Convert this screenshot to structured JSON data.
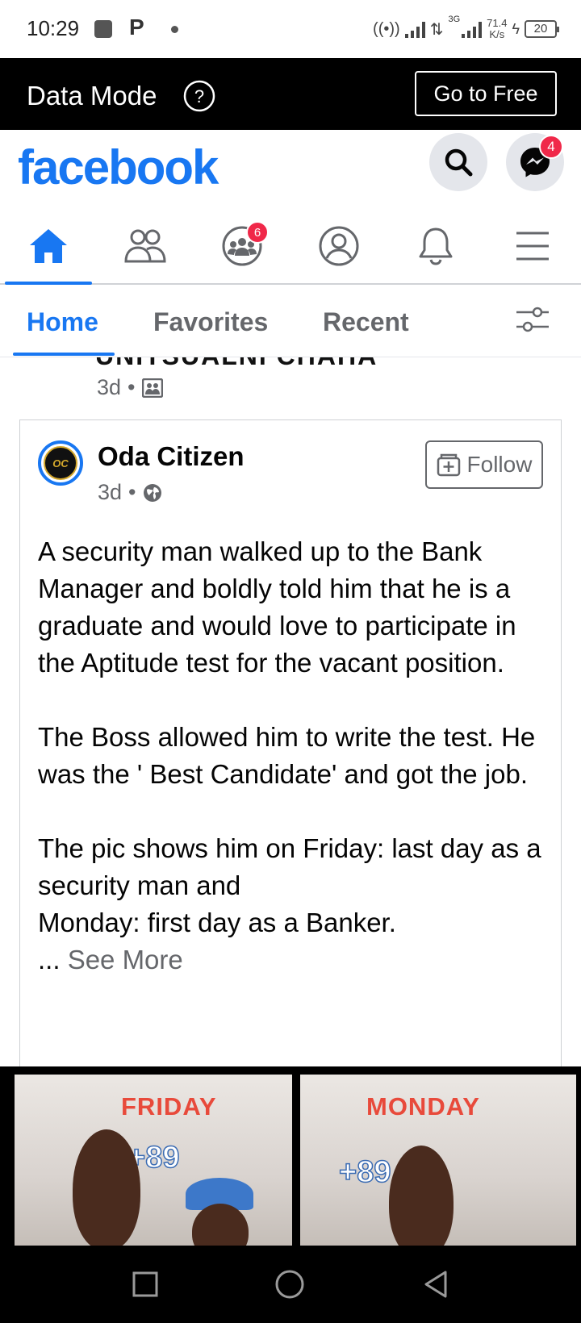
{
  "status_bar": {
    "time": "10:29",
    "p_label": "P",
    "network_type": "3G",
    "speed_value": "71.4",
    "speed_unit": "K/s",
    "battery": "20"
  },
  "data_mode": {
    "title": "Data Mode",
    "help_icon": "question-circle-icon",
    "go_to_free_label": "Go to Free"
  },
  "header": {
    "logo": "facebook",
    "messenger_badge": "4",
    "brand_color": "#1877f2"
  },
  "nav": {
    "groups_badge": "6",
    "items": [
      "home-icon",
      "friends-icon",
      "groups-icon",
      "profile-icon",
      "notifications-icon",
      "menu-icon"
    ]
  },
  "feed_tabs": {
    "home": "Home",
    "favorites": "Favorites",
    "recent": "Recent"
  },
  "previous_post": {
    "title_cut": "UNITSUALNI CHAHA",
    "time": "3d",
    "separator": "•"
  },
  "post": {
    "page_name": "Oda Citizen",
    "avatar_text": "OC",
    "time": "3d",
    "separator": "•",
    "follow_label": "Follow",
    "paragraph1": "A security man walked up to the Bank Manager and boldly told him that he is a graduate and would love to participate in the Aptitude test for the vacant position.",
    "paragraph2": "The Boss allowed him to write the test. He was the ' Best Candidate' and got the job.",
    "paragraph3_line1": "The pic shows him on Friday: last day as a security man and",
    "paragraph3_line2": "Monday: first day as a Banker.",
    "ellipsis": "...",
    "see_more": "See More"
  },
  "post_image": {
    "left_label": "FRIDAY",
    "right_label": "MONDAY",
    "left_number": "+89",
    "right_number": "+89"
  }
}
